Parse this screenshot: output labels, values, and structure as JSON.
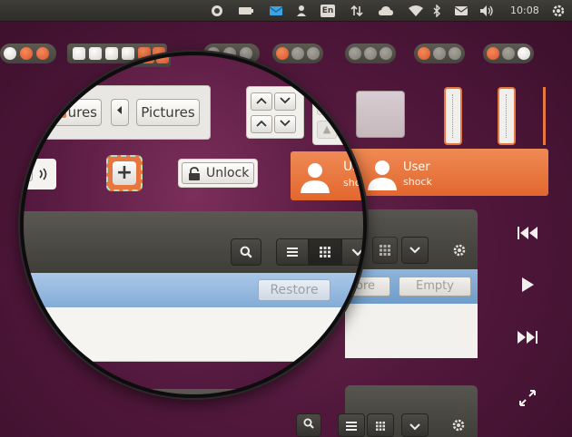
{
  "panel": {
    "clock": "10:08",
    "indicators": [
      "chat-icon",
      "battery-icon",
      "mail-icon",
      "user-icon",
      "keyboard-icon",
      "transfer-icon",
      "cloud-icon",
      "wifi-icon",
      "bluetooth-icon",
      "envelope-icon",
      "volume-icon",
      "power-icon"
    ],
    "keyboard_label": "En",
    "accent": "#3aa4e5"
  },
  "breadcrumbs": {
    "home": "home",
    "pictures_partial": "ures",
    "pictures": "Pictures"
  },
  "unlock": {
    "label": "Unlock"
  },
  "user": {
    "name": "User",
    "name_partial": "Us",
    "status": "shock",
    "status_partial": "shoc"
  },
  "toolbar": {
    "restore": "Restore",
    "store_partial": "tore",
    "empty": "Empty"
  },
  "colors": {
    "orange": "#e8773f",
    "selection": "#86aed7",
    "dark": "#45433e"
  }
}
